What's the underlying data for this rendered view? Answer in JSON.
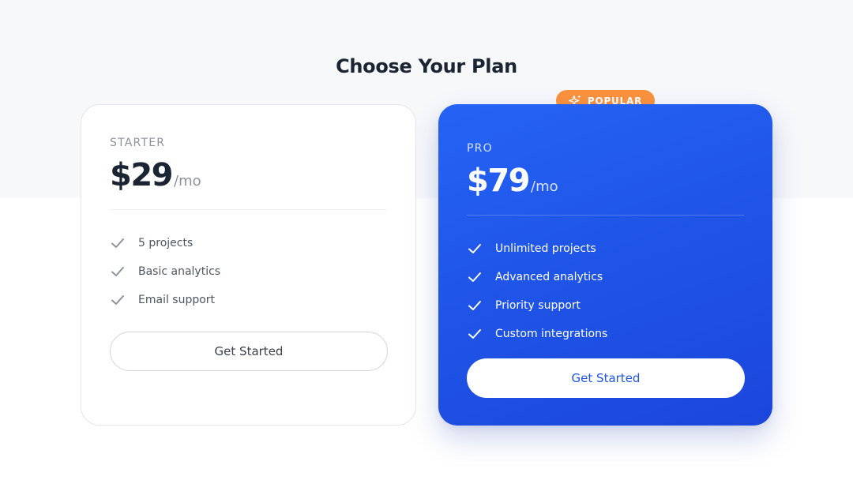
{
  "page": {
    "title": "Choose Your Plan"
  },
  "plans": [
    {
      "name": "STARTER",
      "price": "$29",
      "period": "/mo",
      "features": [
        "5 projects",
        "Basic analytics",
        "Email support"
      ],
      "cta_label": "Get Started",
      "check_color": "#8d939b"
    },
    {
      "name": "PRO",
      "price": "$79",
      "period": "/mo",
      "features": [
        "Unlimited projects",
        "Advanced analytics",
        "Priority support",
        "Custom integrations"
      ],
      "cta_label": "Get Started",
      "check_color": "#ffffff",
      "badge": {
        "label": "POPULAR",
        "icon": "sparkle-icon",
        "color": "#fb923c"
      }
    }
  ],
  "colors": {
    "accent": "#2563f5",
    "text_dark": "#1b2433",
    "badge": "#fb923c"
  },
  "icons": {
    "feature_check": "check-icon"
  }
}
